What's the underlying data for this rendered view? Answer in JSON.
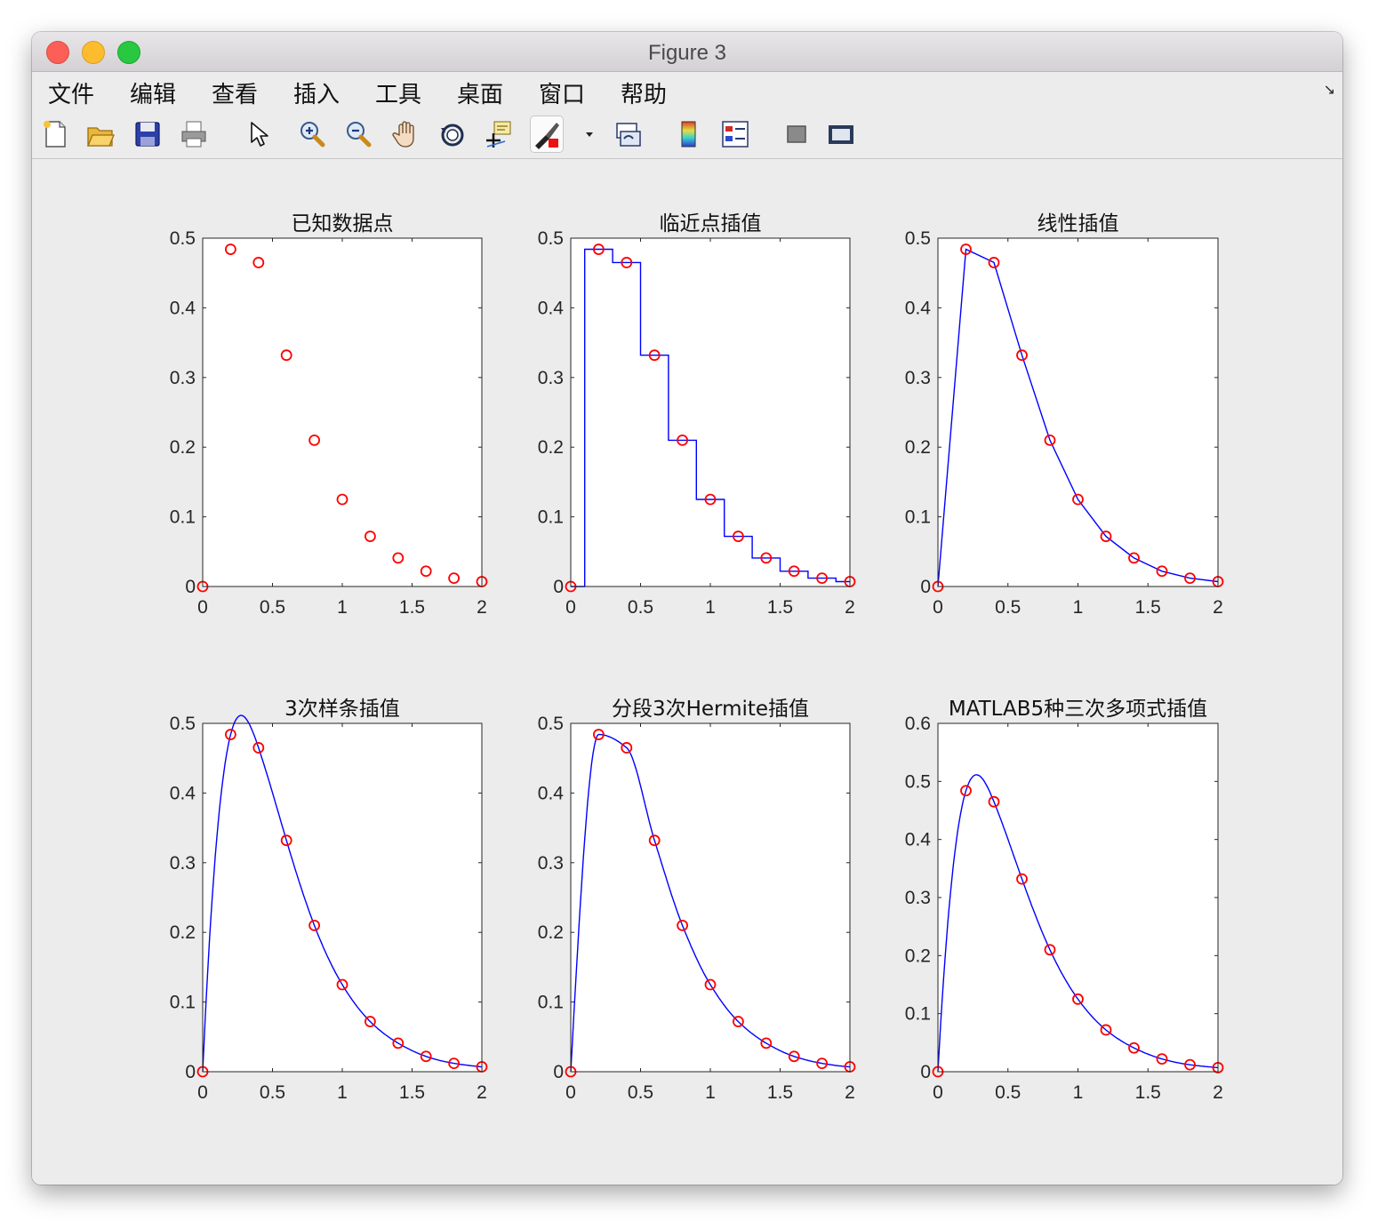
{
  "window": {
    "title": "Figure 3"
  },
  "menu": [
    "文件",
    "编辑",
    "查看",
    "插入",
    "工具",
    "桌面",
    "窗口",
    "帮助"
  ],
  "toolbar": {
    "icons": [
      "new-figure-icon",
      "open-file-icon",
      "save-icon",
      "print-icon",
      "pointer-icon",
      "zoom-in-icon",
      "zoom-out-icon",
      "pan-hand-icon",
      "rotate-3d-icon",
      "data-cursor-icon",
      "brush-icon",
      "dropdown-arrow-icon",
      "link-plot-icon",
      "colorbar-icon",
      "legend-icon",
      "hide-plot-tools-icon",
      "show-plot-tools-icon"
    ]
  },
  "colors": {
    "marker": "#ff0000",
    "curve": "#0000ff",
    "axes_bg": "#ffffff",
    "figure_bg": "#ececec"
  },
  "chart_data": [
    {
      "type": "scatter",
      "title": "已知数据点",
      "x": [
        0,
        0.2,
        0.4,
        0.6,
        0.8,
        1.0,
        1.2,
        1.4,
        1.6,
        1.8,
        2.0
      ],
      "y": [
        0,
        0.484,
        0.465,
        0.332,
        0.21,
        0.125,
        0.072,
        0.041,
        0.022,
        0.012,
        0.007
      ],
      "xlim": [
        0,
        2
      ],
      "ylim": [
        0,
        0.5
      ],
      "xticks": [
        "0",
        "0.5",
        "1",
        "1.5",
        "2"
      ],
      "yticks": [
        "0",
        "0.1",
        "0.2",
        "0.3",
        "0.4",
        "0.5"
      ],
      "method": "none"
    },
    {
      "type": "line",
      "title": "临近点插值",
      "x": [
        0,
        0.2,
        0.4,
        0.6,
        0.8,
        1.0,
        1.2,
        1.4,
        1.6,
        1.8,
        2.0
      ],
      "y": [
        0,
        0.484,
        0.465,
        0.332,
        0.21,
        0.125,
        0.072,
        0.041,
        0.022,
        0.012,
        0.007
      ],
      "xlim": [
        0,
        2
      ],
      "ylim": [
        0,
        0.5
      ],
      "xticks": [
        "0",
        "0.5",
        "1",
        "1.5",
        "2"
      ],
      "yticks": [
        "0",
        "0.1",
        "0.2",
        "0.3",
        "0.4",
        "0.5"
      ],
      "method": "nearest"
    },
    {
      "type": "line",
      "title": "线性插值",
      "x": [
        0,
        0.2,
        0.4,
        0.6,
        0.8,
        1.0,
        1.2,
        1.4,
        1.6,
        1.8,
        2.0
      ],
      "y": [
        0,
        0.484,
        0.465,
        0.332,
        0.21,
        0.125,
        0.072,
        0.041,
        0.022,
        0.012,
        0.007
      ],
      "xlim": [
        0,
        2
      ],
      "ylim": [
        0,
        0.5
      ],
      "xticks": [
        "0",
        "0.5",
        "1",
        "1.5",
        "2"
      ],
      "yticks": [
        "0",
        "0.1",
        "0.2",
        "0.3",
        "0.4",
        "0.5"
      ],
      "method": "linear"
    },
    {
      "type": "line",
      "title": "3次样条插值",
      "x": [
        0,
        0.2,
        0.4,
        0.6,
        0.8,
        1.0,
        1.2,
        1.4,
        1.6,
        1.8,
        2.0
      ],
      "y": [
        0,
        0.484,
        0.465,
        0.332,
        0.21,
        0.125,
        0.072,
        0.041,
        0.022,
        0.012,
        0.007
      ],
      "xlim": [
        0,
        2
      ],
      "ylim": [
        0,
        0.5
      ],
      "xticks": [
        "0",
        "0.5",
        "1",
        "1.5",
        "2"
      ],
      "yticks": [
        "0",
        "0.1",
        "0.2",
        "0.3",
        "0.4",
        "0.5"
      ],
      "method": "spline"
    },
    {
      "type": "line",
      "title": "分段3次Hermite插值",
      "x": [
        0,
        0.2,
        0.4,
        0.6,
        0.8,
        1.0,
        1.2,
        1.4,
        1.6,
        1.8,
        2.0
      ],
      "y": [
        0,
        0.484,
        0.465,
        0.332,
        0.21,
        0.125,
        0.072,
        0.041,
        0.022,
        0.012,
        0.007
      ],
      "xlim": [
        0,
        2
      ],
      "ylim": [
        0,
        0.5
      ],
      "xticks": [
        "0",
        "0.5",
        "1",
        "1.5",
        "2"
      ],
      "yticks": [
        "0",
        "0.1",
        "0.2",
        "0.3",
        "0.4",
        "0.5"
      ],
      "method": "pchip"
    },
    {
      "type": "line",
      "title": "MATLAB5种三次多项式插值",
      "x": [
        0,
        0.2,
        0.4,
        0.6,
        0.8,
        1.0,
        1.2,
        1.4,
        1.6,
        1.8,
        2.0
      ],
      "y": [
        0,
        0.484,
        0.465,
        0.332,
        0.21,
        0.125,
        0.072,
        0.041,
        0.022,
        0.012,
        0.007
      ],
      "xlim": [
        0,
        2
      ],
      "ylim": [
        0,
        0.6
      ],
      "xticks": [
        "0",
        "0.5",
        "1",
        "1.5",
        "2"
      ],
      "yticks": [
        "0",
        "0.1",
        "0.2",
        "0.3",
        "0.4",
        "0.5",
        "0.6"
      ],
      "method": "spline"
    }
  ]
}
